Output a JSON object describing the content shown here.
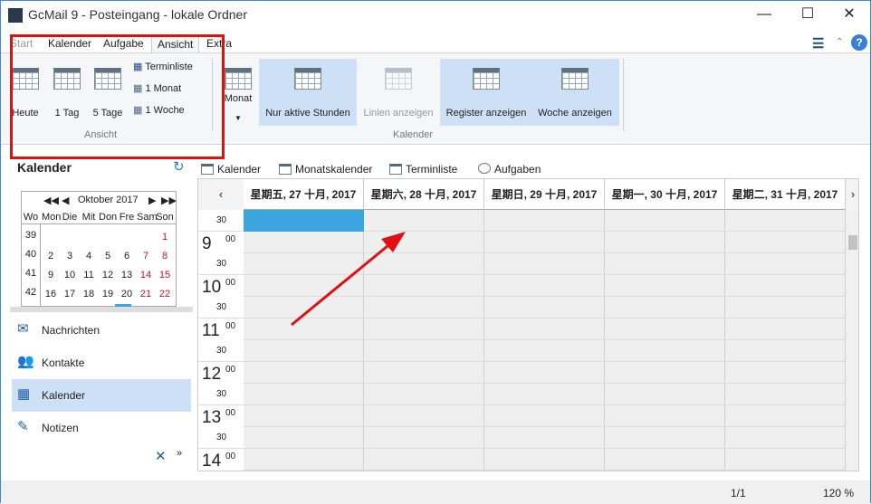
{
  "window": {
    "title": "GcMail 9 - Posteingang - lokale Ordner",
    "minimize": "—",
    "maximize": "☐",
    "close": "✕"
  },
  "ribbon_tabs": [
    {
      "label": "Start"
    },
    {
      "label": "Kalender"
    },
    {
      "label": "Aufgabe"
    },
    {
      "label": "Ansicht",
      "active": true
    },
    {
      "label": "Extra"
    }
  ],
  "ribbon": {
    "ansicht": {
      "label": "Ansicht",
      "buttons": [
        "Heute",
        "1 Tag",
        "5 Tage"
      ],
      "small": [
        "Terminliste",
        "1 Monat",
        "1 Woche"
      ]
    },
    "kalender": {
      "label": "Kalender",
      "monat": "Monat",
      "buttons": [
        {
          "label": "Nur aktive Stunden",
          "selected": true
        },
        {
          "label": "Linien anzeigen",
          "disabled": true
        },
        {
          "label": "Register anzeigen",
          "selected": true
        },
        {
          "label": "Woche anzeigen",
          "selected": true
        }
      ]
    }
  },
  "left_pane": {
    "title": "Kalender",
    "minical": {
      "month": "Oktober 2017",
      "headers": [
        "Wo",
        "Mon",
        "Die",
        "Mit",
        "Don",
        "Fre",
        "Sam",
        "Son"
      ],
      "weeks": [
        {
          "wk": "39",
          "days": [
            "",
            "",
            "",
            "",
            "",
            "",
            "1"
          ]
        },
        {
          "wk": "40",
          "days": [
            "2",
            "3",
            "4",
            "5",
            "6",
            "7",
            "8"
          ]
        },
        {
          "wk": "41",
          "days": [
            "9",
            "10",
            "11",
            "12",
            "13",
            "14",
            "15"
          ]
        },
        {
          "wk": "42",
          "days": [
            "16",
            "17",
            "18",
            "19",
            "20",
            "21",
            "22"
          ]
        }
      ]
    },
    "nav": [
      {
        "label": "Nachrichten",
        "icon": "envelope-icon"
      },
      {
        "label": "Kontakte",
        "icon": "contacts-icon"
      },
      {
        "label": "Kalender",
        "icon": "calendar-icon",
        "selected": true
      },
      {
        "label": "Notizen",
        "icon": "notes-icon"
      }
    ]
  },
  "view_tabs": [
    "Kalender",
    "Monatskalender",
    "Terminliste",
    "Aufgaben"
  ],
  "calendar": {
    "days": [
      "星期五, 27 十月, 2017",
      "星期六, 28 十月, 2017",
      "星期日, 29 十月, 2017",
      "星期一, 30 十月, 2017",
      "星期二, 31 十月, 2017"
    ],
    "slots": [
      {
        "h": "",
        "m": "30"
      },
      {
        "h": "9",
        "m": "00"
      },
      {
        "h": "",
        "m": "30"
      },
      {
        "h": "10",
        "m": "00"
      },
      {
        "h": "",
        "m": "30"
      },
      {
        "h": "11",
        "m": "00"
      },
      {
        "h": "",
        "m": "30"
      },
      {
        "h": "12",
        "m": "00"
      },
      {
        "h": "",
        "m": "30"
      },
      {
        "h": "13",
        "m": "00"
      },
      {
        "h": "",
        "m": "30"
      },
      {
        "h": "14",
        "m": "00"
      }
    ]
  },
  "status": {
    "page": "1/1",
    "zoom": "120 %"
  },
  "colors": {
    "accent": "#3ca4df",
    "selected": "#cde0f5",
    "weekend": "#c8102e",
    "annotation": "#e01010"
  }
}
